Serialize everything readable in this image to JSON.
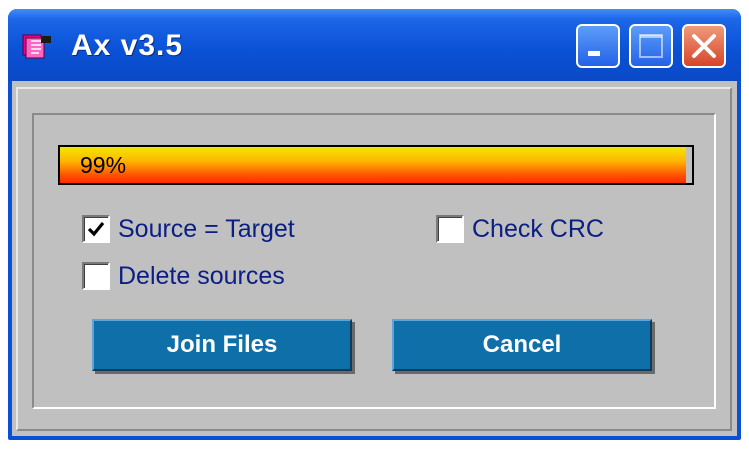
{
  "window": {
    "title": "Ax v3.5",
    "controls": {
      "minimize": "minimize-icon",
      "maximize": "maximize-icon",
      "close": "close-icon"
    }
  },
  "progress": {
    "label": "99%",
    "value": 0.99
  },
  "options": {
    "source_target": {
      "label": "Source = Target",
      "checked": true
    },
    "check_crc": {
      "label": "Check CRC",
      "checked": false
    },
    "delete_sources": {
      "label": "Delete sources",
      "checked": false
    }
  },
  "buttons": {
    "join": "Join Files",
    "cancel": "Cancel"
  },
  "colors": {
    "titlebar": "#0a4fd8",
    "button": "#0f6fa8",
    "close_button": "#d6452a",
    "label_text": "#0a1e84",
    "progress_start": "#f2e800",
    "progress_end": "#ff2a00"
  }
}
